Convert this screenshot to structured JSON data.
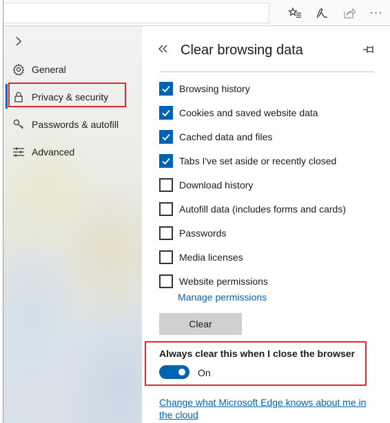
{
  "toolbar": {
    "icons": [
      "favorites-star-icon",
      "pen-icon",
      "share-icon",
      "more-icon"
    ],
    "more_label": "···"
  },
  "sidebar": {
    "items": [
      {
        "label": "General",
        "icon": "gear-icon"
      },
      {
        "label": "Privacy & security",
        "icon": "lock-icon",
        "selected": true
      },
      {
        "label": "Passwords & autofill",
        "icon": "key-icon"
      },
      {
        "label": "Advanced",
        "icon": "sliders-icon"
      }
    ]
  },
  "pane": {
    "title": "Clear browsing data",
    "options": [
      {
        "label": "Browsing history",
        "checked": true
      },
      {
        "label": "Cookies and saved website data",
        "checked": true
      },
      {
        "label": "Cached data and files",
        "checked": true
      },
      {
        "label": "Tabs I've set aside or recently closed",
        "checked": true
      },
      {
        "label": "Download history",
        "checked": false
      },
      {
        "label": "Autofill data (includes forms and cards)",
        "checked": false
      },
      {
        "label": "Passwords",
        "checked": false
      },
      {
        "label": "Media licenses",
        "checked": false
      },
      {
        "label": "Website permissions",
        "checked": false
      }
    ],
    "manage_permissions": "Manage permissions",
    "clear_label": "Clear",
    "always_clear": {
      "label": "Always clear this when I close the browser",
      "state": "On",
      "on": true
    },
    "cloud_link": "Change what Microsoft Edge knows about me in the cloud"
  },
  "colors": {
    "accent": "#0063b1",
    "highlight_box": "#e3242b"
  }
}
